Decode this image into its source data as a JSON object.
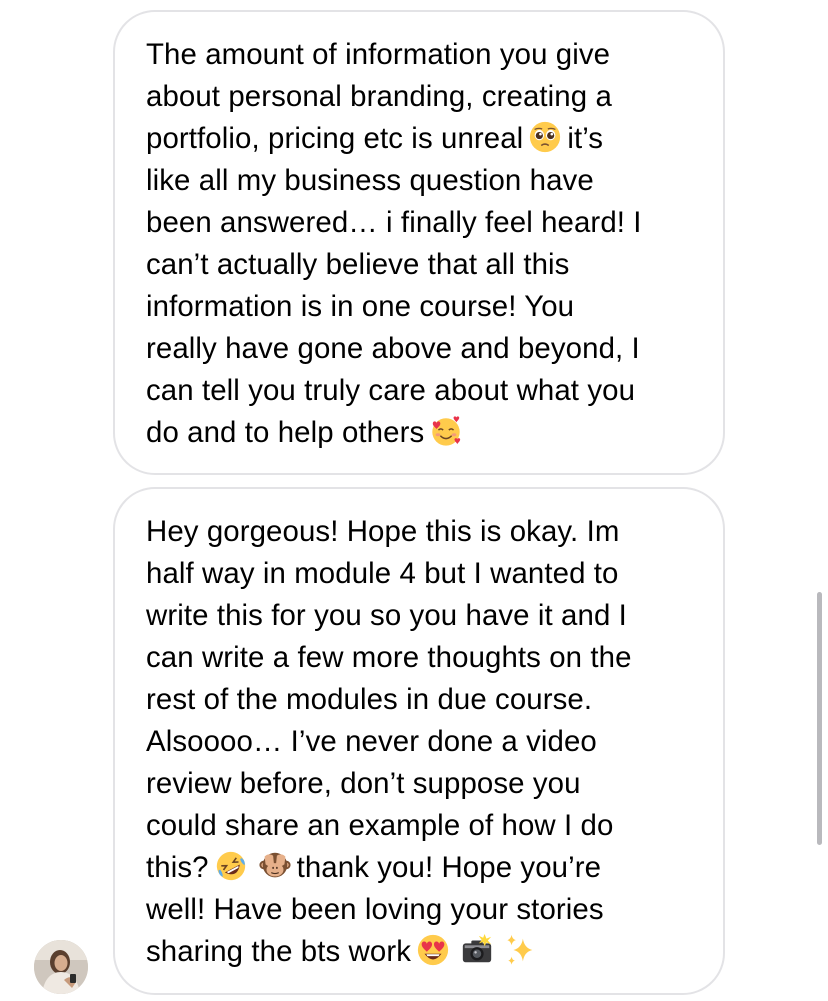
{
  "messages": [
    {
      "id": "message-1",
      "lines": [
        {
          "segments": [
            {
              "type": "text",
              "value": "The amount of information you give"
            }
          ]
        },
        {
          "segments": [
            {
              "type": "text",
              "value": "about personal branding, creating a"
            }
          ]
        },
        {
          "segments": [
            {
              "type": "text",
              "value": "portfolio, pricing etc is unreal"
            },
            {
              "type": "emoji",
              "name": "pleading-face-emoji"
            },
            {
              "type": "text",
              "value": "it’s"
            }
          ]
        },
        {
          "segments": [
            {
              "type": "text",
              "value": "like all my business question have"
            }
          ]
        },
        {
          "segments": [
            {
              "type": "text",
              "value": "been answered… i finally feel heard! I"
            }
          ]
        },
        {
          "segments": [
            {
              "type": "text",
              "value": "can’t actually believe that all this"
            }
          ]
        },
        {
          "segments": [
            {
              "type": "text",
              "value": "information is in one course! You"
            }
          ]
        },
        {
          "segments": [
            {
              "type": "text",
              "value": "really have gone above and beyond, I"
            }
          ]
        },
        {
          "segments": [
            {
              "type": "text",
              "value": "can tell you truly care about what you"
            }
          ]
        },
        {
          "segments": [
            {
              "type": "text",
              "value": "do and to help others"
            },
            {
              "type": "emoji",
              "name": "smiling-face-with-hearts-emoji"
            }
          ]
        }
      ]
    },
    {
      "id": "message-2",
      "lines": [
        {
          "segments": [
            {
              "type": "text",
              "value": "Hey gorgeous! Hope this is okay. Im"
            }
          ]
        },
        {
          "segments": [
            {
              "type": "text",
              "value": "half way in module 4 but I wanted to"
            }
          ]
        },
        {
          "segments": [
            {
              "type": "text",
              "value": "write this for you so you have it and I"
            }
          ]
        },
        {
          "segments": [
            {
              "type": "text",
              "value": "can write a few more thoughts on the"
            }
          ]
        },
        {
          "segments": [
            {
              "type": "text",
              "value": "rest of the modules in due course."
            }
          ]
        },
        {
          "segments": [
            {
              "type": "text",
              "value": "Alsoooo… I’ve never done a video"
            }
          ]
        },
        {
          "segments": [
            {
              "type": "text",
              "value": "review before, don’t suppose you"
            }
          ]
        },
        {
          "segments": [
            {
              "type": "text",
              "value": "could share an example of how I do"
            }
          ]
        },
        {
          "segments": [
            {
              "type": "text",
              "value": "this?"
            },
            {
              "type": "emoji",
              "name": "rolling-on-floor-laughing-emoji"
            },
            {
              "type": "emoji",
              "name": "see-no-evil-monkey-emoji"
            },
            {
              "type": "text",
              "value": "thank you! Hope you’re"
            }
          ]
        },
        {
          "segments": [
            {
              "type": "text",
              "value": "well! Have been loving your stories"
            }
          ]
        },
        {
          "segments": [
            {
              "type": "text",
              "value": "sharing the bts work"
            },
            {
              "type": "emoji",
              "name": "heart-eyes-emoji"
            },
            {
              "type": "emoji",
              "name": "camera-with-flash-emoji"
            },
            {
              "type": "emoji",
              "name": "sparkles-emoji"
            }
          ]
        }
      ]
    }
  ],
  "sender": {
    "avatar_icon": "avatar"
  },
  "colors": {
    "bubble_border": "#e3e3e6",
    "text": "#000000",
    "background": "#ffffff",
    "scrollbar": "#b9b9bd"
  }
}
